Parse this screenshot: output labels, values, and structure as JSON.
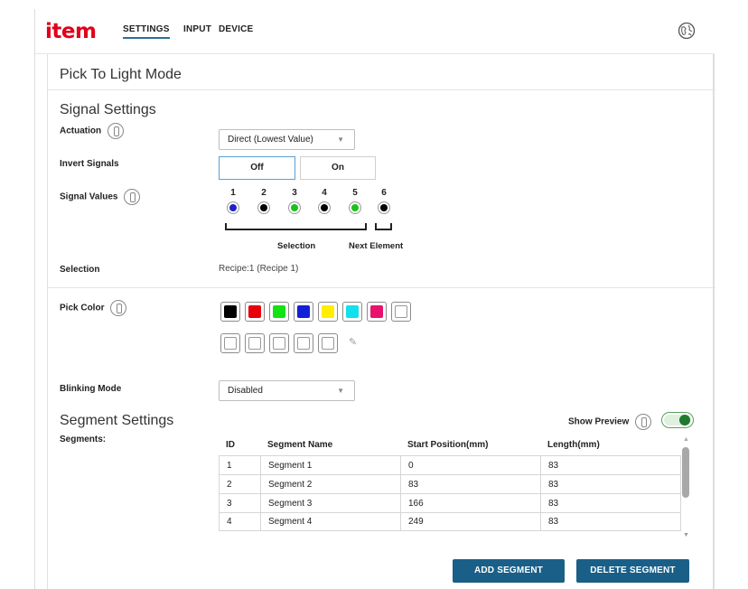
{
  "header": {
    "logo": "item",
    "tabs": [
      {
        "label": "SETTINGS",
        "active": true
      },
      {
        "label": "INPUT",
        "active": false
      },
      {
        "label": "DEVICE",
        "active": false
      }
    ],
    "globe_icon": "globe-icon"
  },
  "page": {
    "title": "Pick To Light Mode"
  },
  "signal_settings": {
    "title": "Signal Settings",
    "actuation": {
      "label": "Actuation",
      "value": "Direct (Lowest Value)"
    },
    "invert_signals": {
      "label": "Invert Signals",
      "off_label": "Off",
      "on_label": "On",
      "selected": "Off"
    },
    "signal_values": {
      "label": "Signal Values",
      "items": [
        {
          "num": "1",
          "color": "#1e22c8"
        },
        {
          "num": "2",
          "color": "#000000"
        },
        {
          "num": "3",
          "color": "#19c219"
        },
        {
          "num": "4",
          "color": "#000000"
        },
        {
          "num": "5",
          "color": "#19c219"
        },
        {
          "num": "6",
          "color": "#000000"
        }
      ],
      "selection_caption": "Selection",
      "next_element_caption": "Next Element"
    },
    "selection": {
      "label": "Selection",
      "value": "Recipe:1 (Recipe 1)"
    }
  },
  "pick_color": {
    "label": "Pick Color",
    "swatches_row1": [
      "#000000",
      "#e8000b",
      "#13e313",
      "#1020d8",
      "#ffee00",
      "#12e0ec",
      "#e8126e",
      "#ffffff"
    ],
    "swatches_row2": [
      "#ffffff",
      "#ffffff",
      "#ffffff",
      "#ffffff",
      "#ffffff"
    ],
    "edit_icon": "pencil-icon"
  },
  "blinking_mode": {
    "label": "Blinking Mode",
    "value": "Disabled"
  },
  "segment_settings": {
    "title": "Segment Settings",
    "segments_label": "Segments:",
    "show_preview_label": "Show Preview",
    "show_preview_on": true,
    "columns": [
      "ID",
      "Segment Name",
      "Start Position(mm)",
      "Length(mm)"
    ],
    "rows": [
      [
        "1",
        "Segment 1",
        "0",
        "83"
      ],
      [
        "2",
        "Segment 2",
        "83",
        "83"
      ],
      [
        "3",
        "Segment 3",
        "166",
        "83"
      ],
      [
        "4",
        "Segment 4",
        "249",
        "83"
      ]
    ],
    "add_button": "ADD SEGMENT",
    "delete_button": "DELETE SEGMENT"
  }
}
